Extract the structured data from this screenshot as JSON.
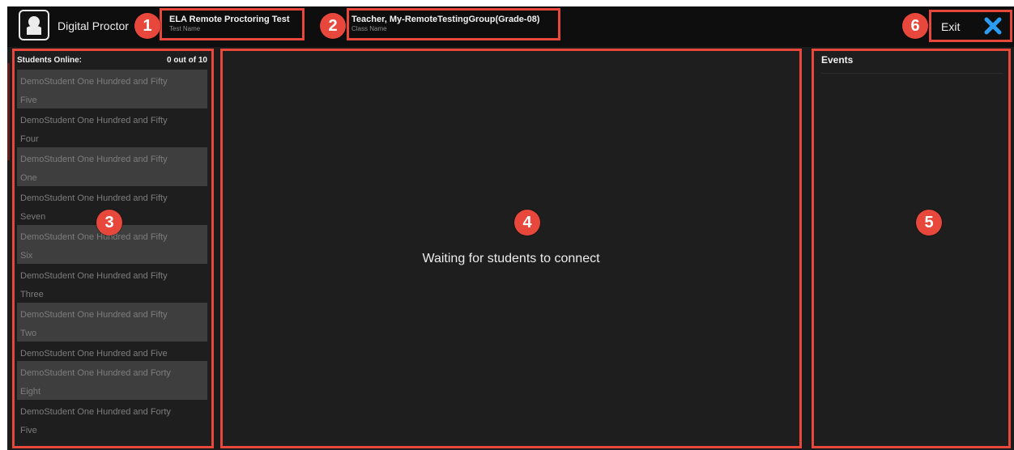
{
  "app": {
    "title": "Digital Proctor"
  },
  "header": {
    "test": {
      "name": "ELA Remote Proctoring Test",
      "caption": "Test Name"
    },
    "class": {
      "name": "Teacher, My-RemoteTestingGroup(Grade-08)",
      "caption": "Class Name"
    },
    "exit_label": "Exit"
  },
  "students": {
    "label": "Students Online:",
    "count": "0 out of 10",
    "items": [
      {
        "line1": "DemoStudent One Hundred and Fifty",
        "line2": "Five"
      },
      {
        "line1": "DemoStudent One Hundred and Fifty",
        "line2": "Four"
      },
      {
        "line1": "DemoStudent One Hundred and Fifty",
        "line2": "One"
      },
      {
        "line1": "DemoStudent One Hundred and Fifty",
        "line2": "Seven"
      },
      {
        "line1": "DemoStudent One Hundred and Fifty",
        "line2": "Six"
      },
      {
        "line1": "DemoStudent One Hundred and Fifty",
        "line2": "Three"
      },
      {
        "line1": "DemoStudent One Hundred and Fifty",
        "line2": "Two"
      },
      {
        "line1": "DemoStudent One Hundred and Five",
        "line2": ""
      },
      {
        "line1": "DemoStudent One Hundred and Forty",
        "line2": "Eight"
      },
      {
        "line1": "DemoStudent One Hundred and Forty",
        "line2": "Five"
      }
    ]
  },
  "main": {
    "waiting_message": "Waiting for students to connect"
  },
  "events": {
    "title": "Events"
  },
  "callouts": [
    "1",
    "2",
    "3",
    "4",
    "5",
    "6"
  ],
  "colors": {
    "callout": "#e8483c",
    "topbar": "#0e0e0e",
    "background": "#1b1b1b",
    "row_shaded": "#3e3e3e",
    "exit_icon": "#2a9df4"
  }
}
